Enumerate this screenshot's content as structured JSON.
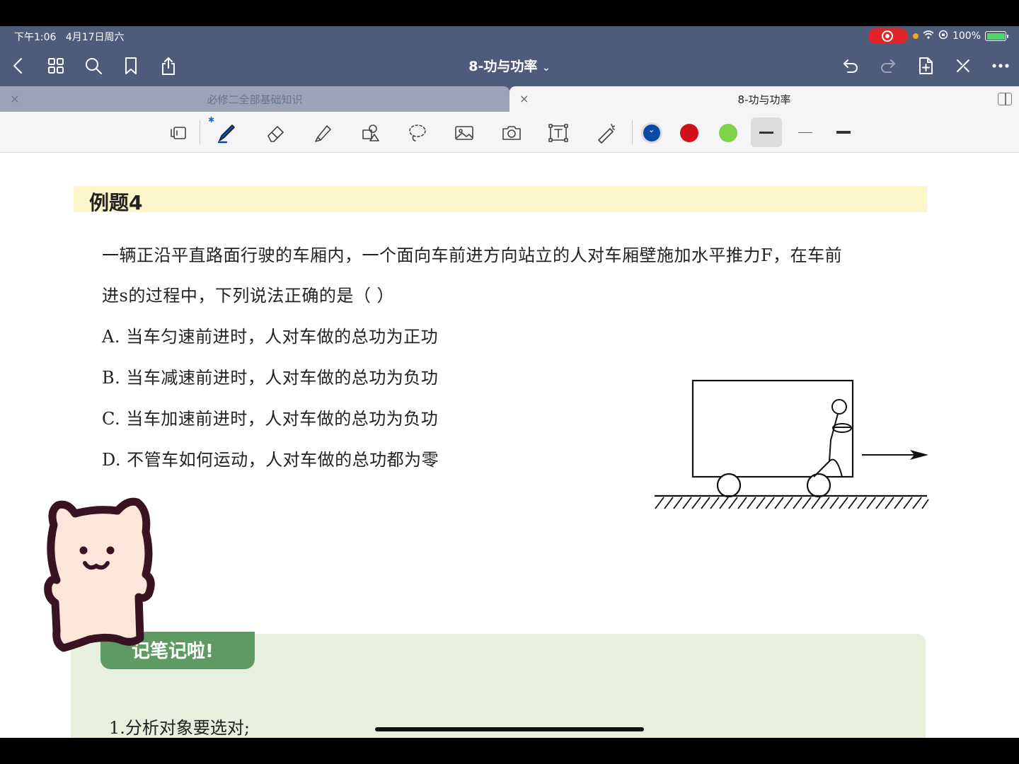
{
  "status_bar": {
    "time": "下午1:06",
    "date": "4月17日周六",
    "battery": "100%"
  },
  "nav": {
    "doc_title": "8-功与功率",
    "title_chevron": "⌄"
  },
  "tabs": [
    {
      "label": "必修二全部基础知识",
      "active": false,
      "close": "×"
    },
    {
      "label": "8-功与功率",
      "active": true,
      "close": "×"
    }
  ],
  "toolbar": {
    "colors": [
      "#0b4aa2",
      "#d0101a",
      "#7ed24a"
    ],
    "selected_color_mark": "⌄",
    "icons": [
      "page-flip-icon",
      "pen-icon",
      "eraser-icon",
      "highlighter-icon",
      "shapes-icon",
      "lasso-icon",
      "image-icon",
      "camera-icon",
      "text-icon",
      "laser-pointer-icon"
    ]
  },
  "document": {
    "example_title": "例题4",
    "question_line1": "一辆正沿平直路面行驶的车厢内，一个面向车前进方向站立的人对车厢壁施加水平推力F，在车前",
    "question_line2": "进s的过程中，下列说法正确的是（      ）",
    "options": [
      "A. 当车匀速前进时，人对车做的总功为正功",
      "B. 当车减速前进时，人对车做的总功为负功",
      "C. 当车加速前进时，人对车做的总功为负功",
      "D. 不管车如何运动，人对车做的总功都为零"
    ],
    "notes_tag": "记笔记啦!",
    "note_1": "1.分析对象要选对;"
  }
}
